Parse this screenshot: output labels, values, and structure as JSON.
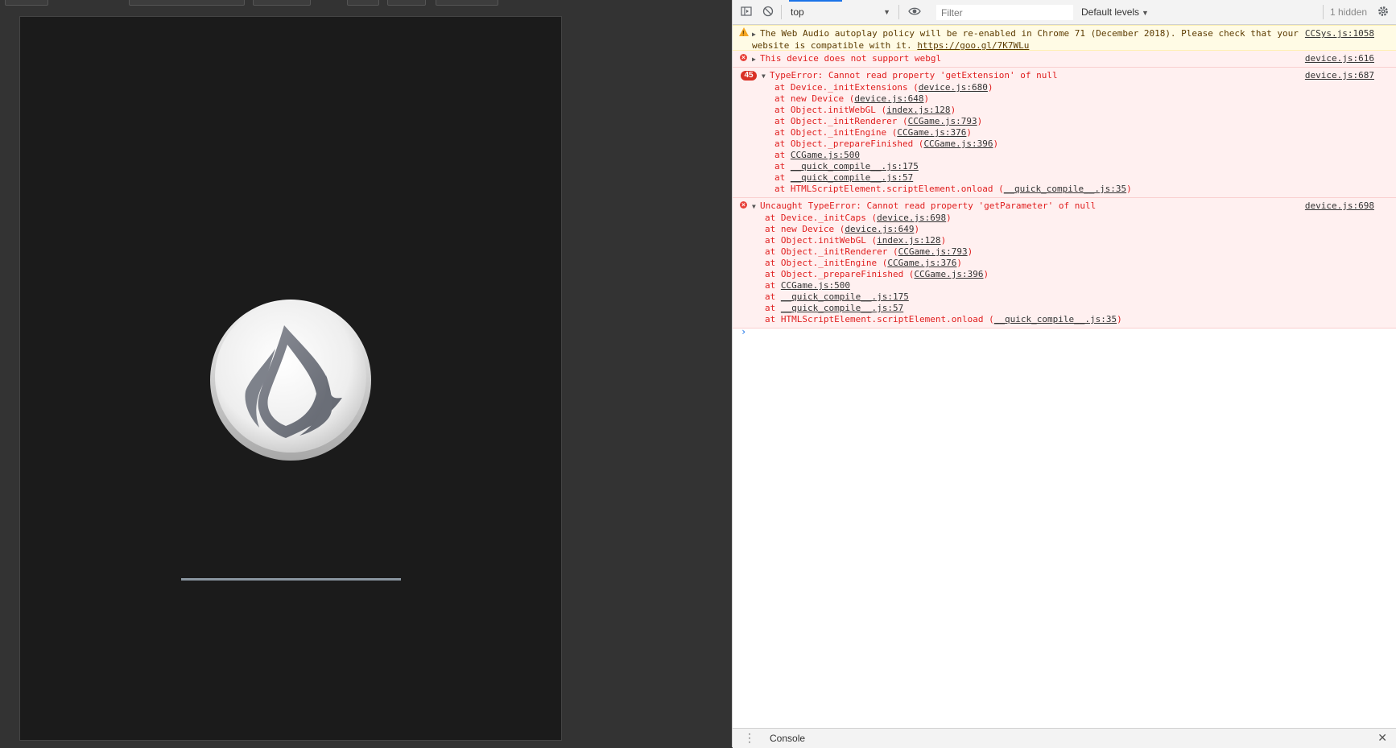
{
  "preview": {
    "loading_progress": 1.0,
    "logo_icon": "cocos-flame-logo"
  },
  "devtools": {
    "toolbar": {
      "context": "top",
      "filter_placeholder": "Filter",
      "levels": "Default levels",
      "hidden": "1 hidden"
    },
    "messages": {
      "warn1": {
        "text_a": "The Web Audio autoplay policy will be re-enabled in Chrome 71 (December 2018). Please check that your",
        "text_b": "website is compatible with it. ",
        "link": "https://goo.gl/7K7WLu",
        "source": "CCSys.js:1058"
      },
      "err1": {
        "text": "This device does not support webgl",
        "source": "device.js:616"
      },
      "err2": {
        "count": "45",
        "text": "TypeError: Cannot read property 'getExtension' of null",
        "source": "device.js:687",
        "stack": [
          {
            "prefix": "at Device._initExtensions (",
            "link": "device.js:680",
            "suffix": ")"
          },
          {
            "prefix": "at new Device (",
            "link": "device.js:648",
            "suffix": ")"
          },
          {
            "prefix": "at Object.initWebGL (",
            "link": "index.js:128",
            "suffix": ")"
          },
          {
            "prefix": "at Object._initRenderer (",
            "link": "CCGame.js:793",
            "suffix": ")"
          },
          {
            "prefix": "at Object._initEngine (",
            "link": "CCGame.js:376",
            "suffix": ")"
          },
          {
            "prefix": "at Object._prepareFinished (",
            "link": "CCGame.js:396",
            "suffix": ")"
          },
          {
            "prefix": "at ",
            "link": "CCGame.js:500",
            "suffix": ""
          },
          {
            "prefix": "at ",
            "link": "__quick_compile__.js:175",
            "suffix": ""
          },
          {
            "prefix": "at ",
            "link": "__quick_compile__.js:57",
            "suffix": ""
          },
          {
            "prefix": "at HTMLScriptElement.scriptElement.onload (",
            "link": "__quick_compile__.js:35",
            "suffix": ")"
          }
        ]
      },
      "err3": {
        "text": "Uncaught TypeError: Cannot read property 'getParameter' of null",
        "source": "device.js:698",
        "stack": [
          {
            "prefix": "at Device._initCaps (",
            "link": "device.js:698",
            "suffix": ")"
          },
          {
            "prefix": "at new Device (",
            "link": "device.js:649",
            "suffix": ")"
          },
          {
            "prefix": "at Object.initWebGL (",
            "link": "index.js:128",
            "suffix": ")"
          },
          {
            "prefix": "at Object._initRenderer (",
            "link": "CCGame.js:793",
            "suffix": ")"
          },
          {
            "prefix": "at Object._initEngine (",
            "link": "CCGame.js:376",
            "suffix": ")"
          },
          {
            "prefix": "at Object._prepareFinished (",
            "link": "CCGame.js:396",
            "suffix": ")"
          },
          {
            "prefix": "at ",
            "link": "CCGame.js:500",
            "suffix": ""
          },
          {
            "prefix": "at ",
            "link": "__quick_compile__.js:175",
            "suffix": ""
          },
          {
            "prefix": "at ",
            "link": "__quick_compile__.js:57",
            "suffix": ""
          },
          {
            "prefix": "at HTMLScriptElement.scriptElement.onload (",
            "link": "__quick_compile__.js:35",
            "suffix": ")"
          }
        ]
      }
    },
    "prompt": "›",
    "drawer": {
      "tab": "Console"
    }
  }
}
